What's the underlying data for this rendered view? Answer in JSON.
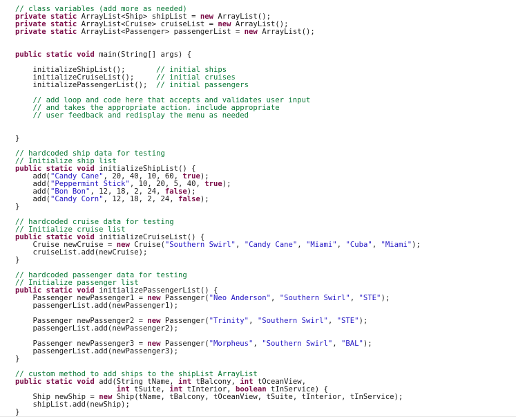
{
  "colors": {
    "background": "#ffffff",
    "comment": "#0c7a38",
    "keyword": "#7a0b46",
    "string": "#2417c4",
    "plain": "#1a1a1a"
  },
  "lines": [
    [
      {
        "t": "comment",
        "s": "// class variables (add more as needed)"
      }
    ],
    [
      {
        "t": "keyword",
        "s": "private static"
      },
      {
        "t": "plain",
        "s": " ArrayList<Ship> shipList = "
      },
      {
        "t": "keyword",
        "s": "new"
      },
      {
        "t": "plain",
        "s": " ArrayList();"
      }
    ],
    [
      {
        "t": "keyword",
        "s": "private static"
      },
      {
        "t": "plain",
        "s": " ArrayList<Cruise> cruiseList = "
      },
      {
        "t": "keyword",
        "s": "new"
      },
      {
        "t": "plain",
        "s": " ArrayList();"
      }
    ],
    [
      {
        "t": "keyword",
        "s": "private static"
      },
      {
        "t": "plain",
        "s": " ArrayList<Passenger> passengerList = "
      },
      {
        "t": "keyword",
        "s": "new"
      },
      {
        "t": "plain",
        "s": " ArrayList();"
      }
    ],
    [],
    [],
    [
      {
        "t": "keyword",
        "s": "public static void"
      },
      {
        "t": "plain",
        "s": " main(String[] args) {"
      }
    ],
    [],
    [
      {
        "t": "plain",
        "s": "    initializeShipList();       "
      },
      {
        "t": "comment",
        "s": "// initial ships"
      }
    ],
    [
      {
        "t": "plain",
        "s": "    initializeCruiseList();     "
      },
      {
        "t": "comment",
        "s": "// initial cruises"
      }
    ],
    [
      {
        "t": "plain",
        "s": "    initializePassengerList();  "
      },
      {
        "t": "comment",
        "s": "// initial passengers"
      }
    ],
    [],
    [
      {
        "t": "comment",
        "s": "    // add loop and code here that accepts and validates user input"
      }
    ],
    [
      {
        "t": "comment",
        "s": "    // and takes the appropriate action. include appropriate"
      }
    ],
    [
      {
        "t": "comment",
        "s": "    // user feedback and redisplay the menu as needed"
      }
    ],
    [],
    [],
    [
      {
        "t": "plain",
        "s": "}"
      }
    ],
    [],
    [
      {
        "t": "comment",
        "s": "// hardcoded ship data for testing"
      }
    ],
    [
      {
        "t": "comment",
        "s": "// Initialize ship list"
      }
    ],
    [
      {
        "t": "keyword",
        "s": "public static void"
      },
      {
        "t": "plain",
        "s": " initializeShipList() {"
      }
    ],
    [
      {
        "t": "plain",
        "s": "    add("
      },
      {
        "t": "string",
        "s": "\"Candy Cane\""
      },
      {
        "t": "plain",
        "s": ", 20, 40, 10, 60, "
      },
      {
        "t": "keyword",
        "s": "true"
      },
      {
        "t": "plain",
        "s": ");"
      }
    ],
    [
      {
        "t": "plain",
        "s": "    add("
      },
      {
        "t": "string",
        "s": "\"Peppermint Stick\""
      },
      {
        "t": "plain",
        "s": ", 10, 20, 5, 40, "
      },
      {
        "t": "keyword",
        "s": "true"
      },
      {
        "t": "plain",
        "s": ");"
      }
    ],
    [
      {
        "t": "plain",
        "s": "    add("
      },
      {
        "t": "string",
        "s": "\"Bon Bon\""
      },
      {
        "t": "plain",
        "s": ", 12, 18, 2, 24, "
      },
      {
        "t": "keyword",
        "s": "false"
      },
      {
        "t": "plain",
        "s": ");"
      }
    ],
    [
      {
        "t": "plain",
        "s": "    add("
      },
      {
        "t": "string",
        "s": "\"Candy Corn\""
      },
      {
        "t": "plain",
        "s": ", 12, 18, 2, 24, "
      },
      {
        "t": "keyword",
        "s": "false"
      },
      {
        "t": "plain",
        "s": ");"
      }
    ],
    [
      {
        "t": "plain",
        "s": "}"
      }
    ],
    [],
    [
      {
        "t": "comment",
        "s": "// hardcoded cruise data for testing"
      }
    ],
    [
      {
        "t": "comment",
        "s": "// Initialize cruise list"
      }
    ],
    [
      {
        "t": "keyword",
        "s": "public static void"
      },
      {
        "t": "plain",
        "s": " initializeCruiseList() {"
      }
    ],
    [
      {
        "t": "plain",
        "s": "    Cruise newCruise = "
      },
      {
        "t": "keyword",
        "s": "new"
      },
      {
        "t": "plain",
        "s": " Cruise("
      },
      {
        "t": "string",
        "s": "\"Southern Swirl\""
      },
      {
        "t": "plain",
        "s": ", "
      },
      {
        "t": "string",
        "s": "\"Candy Cane\""
      },
      {
        "t": "plain",
        "s": ", "
      },
      {
        "t": "string",
        "s": "\"Miami\""
      },
      {
        "t": "plain",
        "s": ", "
      },
      {
        "t": "string",
        "s": "\"Cuba\""
      },
      {
        "t": "plain",
        "s": ", "
      },
      {
        "t": "string",
        "s": "\"Miami\""
      },
      {
        "t": "plain",
        "s": ");"
      }
    ],
    [
      {
        "t": "plain",
        "s": "    cruiseList.add(newCruise);"
      }
    ],
    [
      {
        "t": "plain",
        "s": "}"
      }
    ],
    [],
    [
      {
        "t": "comment",
        "s": "// hardcoded passenger data for testing"
      }
    ],
    [
      {
        "t": "comment",
        "s": "// Initialize passenger list"
      }
    ],
    [
      {
        "t": "keyword",
        "s": "public static void"
      },
      {
        "t": "plain",
        "s": " initializePassengerList() {"
      }
    ],
    [
      {
        "t": "plain",
        "s": "    Passenger newPassenger1 = "
      },
      {
        "t": "keyword",
        "s": "new"
      },
      {
        "t": "plain",
        "s": " Passenger("
      },
      {
        "t": "string",
        "s": "\"Neo Anderson\""
      },
      {
        "t": "plain",
        "s": ", "
      },
      {
        "t": "string",
        "s": "\"Southern Swirl\""
      },
      {
        "t": "plain",
        "s": ", "
      },
      {
        "t": "string",
        "s": "\"STE\""
      },
      {
        "t": "plain",
        "s": ");"
      }
    ],
    [
      {
        "t": "plain",
        "s": "    passengerList.add(newPassenger1);"
      }
    ],
    [],
    [
      {
        "t": "plain",
        "s": "    Passenger newPassenger2 = "
      },
      {
        "t": "keyword",
        "s": "new"
      },
      {
        "t": "plain",
        "s": " Passenger("
      },
      {
        "t": "string",
        "s": "\"Trinity\""
      },
      {
        "t": "plain",
        "s": ", "
      },
      {
        "t": "string",
        "s": "\"Southern Swirl\""
      },
      {
        "t": "plain",
        "s": ", "
      },
      {
        "t": "string",
        "s": "\"STE\""
      },
      {
        "t": "plain",
        "s": ");"
      }
    ],
    [
      {
        "t": "plain",
        "s": "    passengerList.add(newPassenger2);"
      }
    ],
    [],
    [
      {
        "t": "plain",
        "s": "    Passenger newPassenger3 = "
      },
      {
        "t": "keyword",
        "s": "new"
      },
      {
        "t": "plain",
        "s": " Passenger("
      },
      {
        "t": "string",
        "s": "\"Morpheus\""
      },
      {
        "t": "plain",
        "s": ", "
      },
      {
        "t": "string",
        "s": "\"Southern Swirl\""
      },
      {
        "t": "plain",
        "s": ", "
      },
      {
        "t": "string",
        "s": "\"BAL\""
      },
      {
        "t": "plain",
        "s": ");"
      }
    ],
    [
      {
        "t": "plain",
        "s": "    passengerList.add(newPassenger3);"
      }
    ],
    [
      {
        "t": "plain",
        "s": "}"
      }
    ],
    [],
    [
      {
        "t": "comment",
        "s": "// custom method to add ships to the shipList ArrayList"
      }
    ],
    [
      {
        "t": "keyword",
        "s": "public static void"
      },
      {
        "t": "plain",
        "s": " add(String tName, "
      },
      {
        "t": "keyword",
        "s": "int"
      },
      {
        "t": "plain",
        "s": " tBalcony, "
      },
      {
        "t": "keyword",
        "s": "int"
      },
      {
        "t": "plain",
        "s": " tOceanView,"
      }
    ],
    [
      {
        "t": "plain",
        "s": "                       "
      },
      {
        "t": "keyword",
        "s": "int"
      },
      {
        "t": "plain",
        "s": " tSuite, "
      },
      {
        "t": "keyword",
        "s": "int"
      },
      {
        "t": "plain",
        "s": " tInterior, "
      },
      {
        "t": "keyword",
        "s": "boolean"
      },
      {
        "t": "plain",
        "s": " tInService) {"
      }
    ],
    [
      {
        "t": "plain",
        "s": "    Ship newShip = "
      },
      {
        "t": "keyword",
        "s": "new"
      },
      {
        "t": "plain",
        "s": " Ship(tName, tBalcony, tOceanView, tSuite, tInterior, tInService);"
      }
    ],
    [
      {
        "t": "plain",
        "s": "    shipList.add(newShip);"
      }
    ],
    [
      {
        "t": "plain",
        "s": "}"
      }
    ]
  ]
}
